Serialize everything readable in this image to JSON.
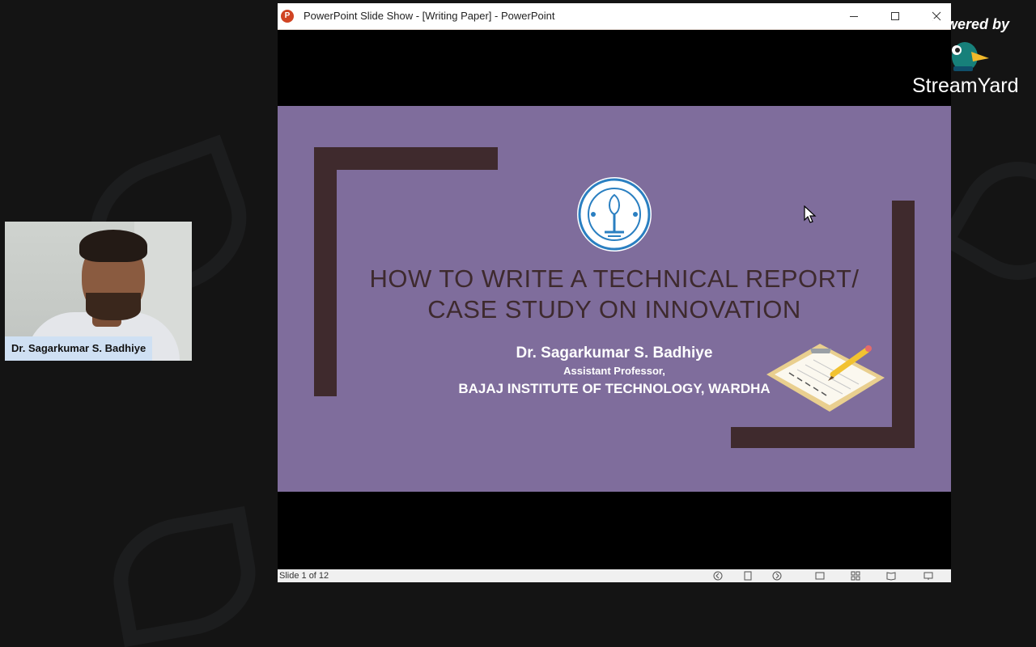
{
  "participant": {
    "name": "Dr. Sagarkumar S. Badhiye"
  },
  "window": {
    "title": "PowerPoint Slide Show - [Writing Paper] - PowerPoint",
    "app_icon_letter": "P"
  },
  "slide": {
    "title_line1": "HOW TO WRITE A TECHNICAL REPORT/",
    "title_line2": "CASE STUDY ON INNOVATION",
    "author": "Dr. Sagarkumar S. Badhiye",
    "role": "Assistant Professor,",
    "institution": "BAJAJ INSTITUTE OF TECHNOLOGY, WARDHA",
    "background_color": "#7f6d9c",
    "accent_color": "#3f2a2d"
  },
  "status": {
    "slide_counter": "Slide 1 of 12"
  },
  "branding": {
    "powered_by": "Powered by",
    "name": "StreamYard"
  }
}
